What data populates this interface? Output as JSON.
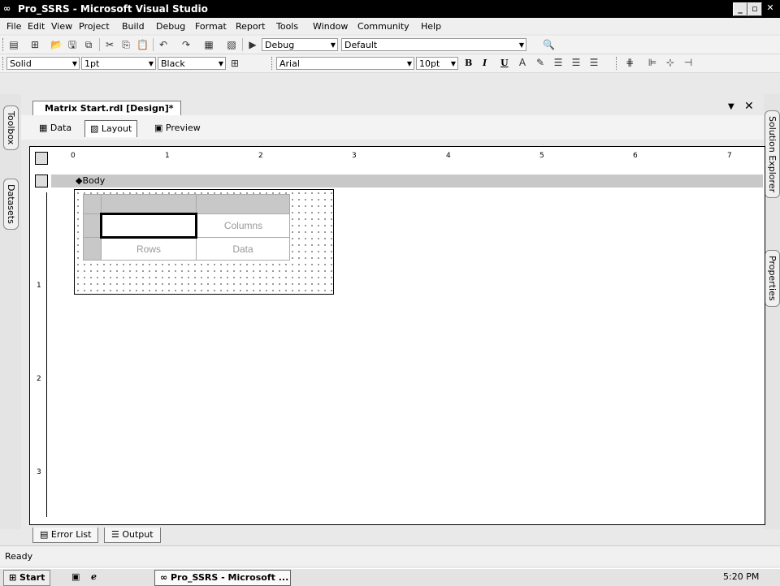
{
  "window": {
    "title": "Pro_SSRS - Microsoft Visual Studio"
  },
  "menu": [
    "File",
    "Edit",
    "View",
    "Project",
    "Build",
    "Debug",
    "Format",
    "Report",
    "Tools",
    "Window",
    "Community",
    "Help"
  ],
  "toolbar1": {
    "config": "Debug",
    "platform": "Default"
  },
  "toolbar2": {
    "line_style": "Solid",
    "line_width": "1pt",
    "line_color": "Black",
    "font": "Arial",
    "font_size": "10pt",
    "bold": "B",
    "italic": "I",
    "underline": "U"
  },
  "side_tabs": {
    "toolbox": "Toolbox",
    "datasets": "Datasets",
    "solution_explorer": "Solution Explorer",
    "properties": "Properties"
  },
  "document": {
    "tab": "Matrix Start.rdl [Design]*",
    "subtabs": [
      "Data",
      "Layout",
      "Preview"
    ],
    "active_subtab": "Layout"
  },
  "ruler": {
    "h": [
      "0",
      "1",
      "2",
      "3",
      "4",
      "5",
      "6",
      "7"
    ],
    "v": [
      "1",
      "2",
      "3"
    ]
  },
  "body_label": "Body",
  "matrix": {
    "columns": "Columns",
    "rows": "Rows",
    "data": "Data"
  },
  "bottom_tabs": [
    "Error List",
    "Output"
  ],
  "status": "Ready",
  "taskbar": {
    "start": "Start",
    "task": "Pro_SSRS - Microsoft ...",
    "clock": "5:20 PM"
  }
}
